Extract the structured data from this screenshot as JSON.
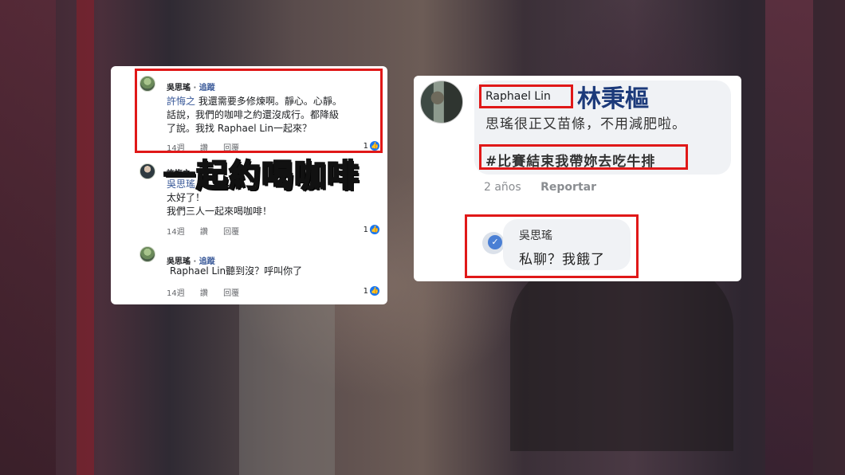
{
  "left_card": {
    "comments": [
      {
        "author": "吳思瑤",
        "follow": "追蹤",
        "mention": "許悔之",
        "line1": "我還需要多修煉啊。靜心。心靜。",
        "line2": "話說，我們的咖啡之約還沒成行。都降級",
        "line3": "了說。我找 Raphael Lin一起來？",
        "time": "14週",
        "reply": "讚",
        "reply2": "回覆",
        "likes": "1"
      },
      {
        "author": "許悔之",
        "mention": "吳思瑤",
        "line1": "太好了！",
        "line2": "我們三人一起來喝咖啡！",
        "time": "14週",
        "reply": "讚",
        "reply2": "回覆",
        "likes": "1"
      },
      {
        "author": "吳思瑤",
        "follow": "追蹤",
        "line1": "Raphael Lin聽到沒？呼叫你了",
        "time": "14週",
        "reply": "讚",
        "reply2": "回覆",
        "likes": "1"
      }
    ],
    "overlay_caption": "一起約喝咖啡"
  },
  "right_card": {
    "author": "Raphael Lin",
    "caption_name": "林秉樞",
    "line1": "思瑤很正又苗條，不用減肥啦。",
    "line2": "#比賽結束我帶妳去吃牛排",
    "time": "2 años",
    "report": "Reportar",
    "reply_author": "吳思瑤",
    "reply_text": "私聊？我餓了"
  },
  "colors": {
    "highlight_red": "#e01818",
    "caption_yellow": "#ffe100",
    "link_blue": "#385898",
    "like_blue": "#1877f2"
  }
}
